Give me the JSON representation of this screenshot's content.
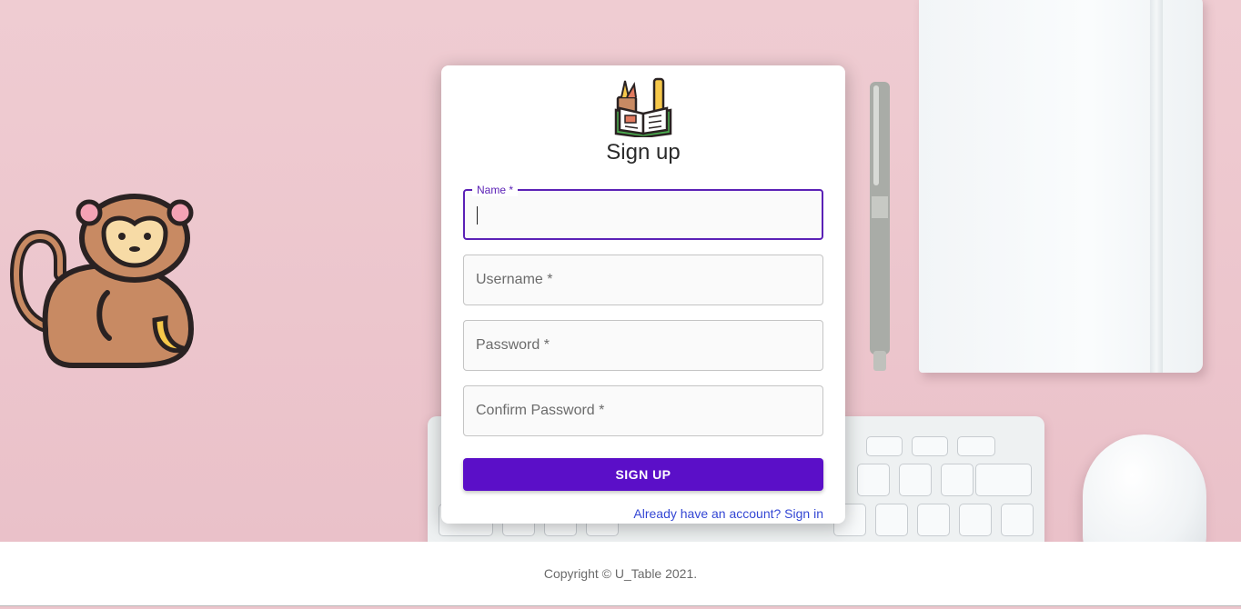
{
  "form": {
    "title": "Sign up",
    "fields": [
      {
        "label": "Name *",
        "value": ""
      },
      {
        "label": "Username *",
        "value": ""
      },
      {
        "label": "Password *",
        "value": ""
      },
      {
        "label": "Confirm Password *",
        "value": ""
      }
    ],
    "submit_label": "SIGN UP",
    "signin_link": "Already have an account? Sign in"
  },
  "footer": {
    "copyright": "Copyright © U_Table 2021."
  },
  "colors": {
    "primary": "#5b0fc8",
    "focus": "#5b21b6",
    "link": "#3447d4",
    "background": "#ecc5cc"
  },
  "icons": {
    "logo": "books-pencil-icon",
    "mascot": "monkey-icon"
  }
}
